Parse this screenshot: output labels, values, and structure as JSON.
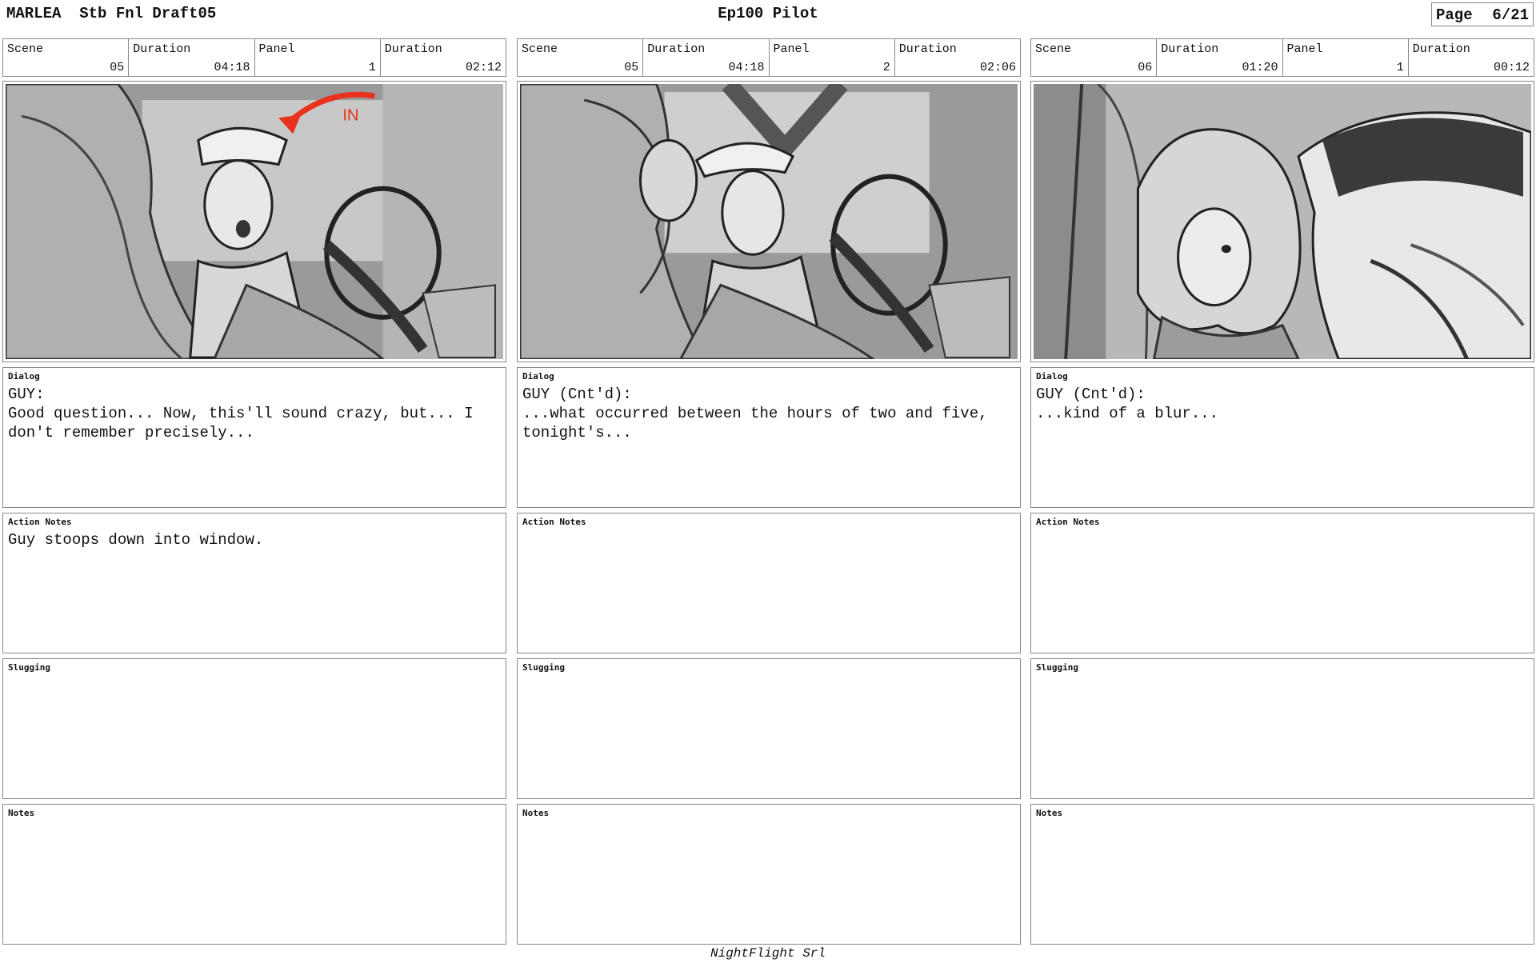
{
  "header": {
    "doc_title": "MARLEA  Stb Fnl Draft05",
    "episode_title": "Ep100 Pilot",
    "page_label": "Page",
    "page_number": "6/21"
  },
  "labels": {
    "scene": "Scene",
    "duration": "Duration",
    "panel": "Panel",
    "dialog": "Dialog",
    "action_notes": "Action Notes",
    "slugging": "Slugging",
    "notes": "Notes"
  },
  "panels": [
    {
      "scene": "05",
      "scene_duration": "04:18",
      "panel": "1",
      "panel_duration": "02:12",
      "dialog": "GUY:\nGood question... Now, this'll sound crazy, but... I\ndon't remember precisely...",
      "action_notes": "Guy stoops down into window.",
      "slugging": "",
      "notes": "",
      "drawing_annotation": "IN"
    },
    {
      "scene": "05",
      "scene_duration": "04:18",
      "panel": "2",
      "panel_duration": "02:06",
      "dialog": "GUY (Cnt'd):\n...what occurred between the hours of two and five,\ntonight's...",
      "action_notes": "",
      "slugging": "",
      "notes": ""
    },
    {
      "scene": "06",
      "scene_duration": "01:20",
      "panel": "1",
      "panel_duration": "00:12",
      "dialog": "GUY (Cnt'd):\n...kind of a blur...",
      "action_notes": "",
      "slugging": "",
      "notes": ""
    }
  ],
  "colors": {
    "annotation_arrow": "#e8321e",
    "sketch_gray": "#8a8a8a"
  },
  "footer": "NightFlight Srl"
}
